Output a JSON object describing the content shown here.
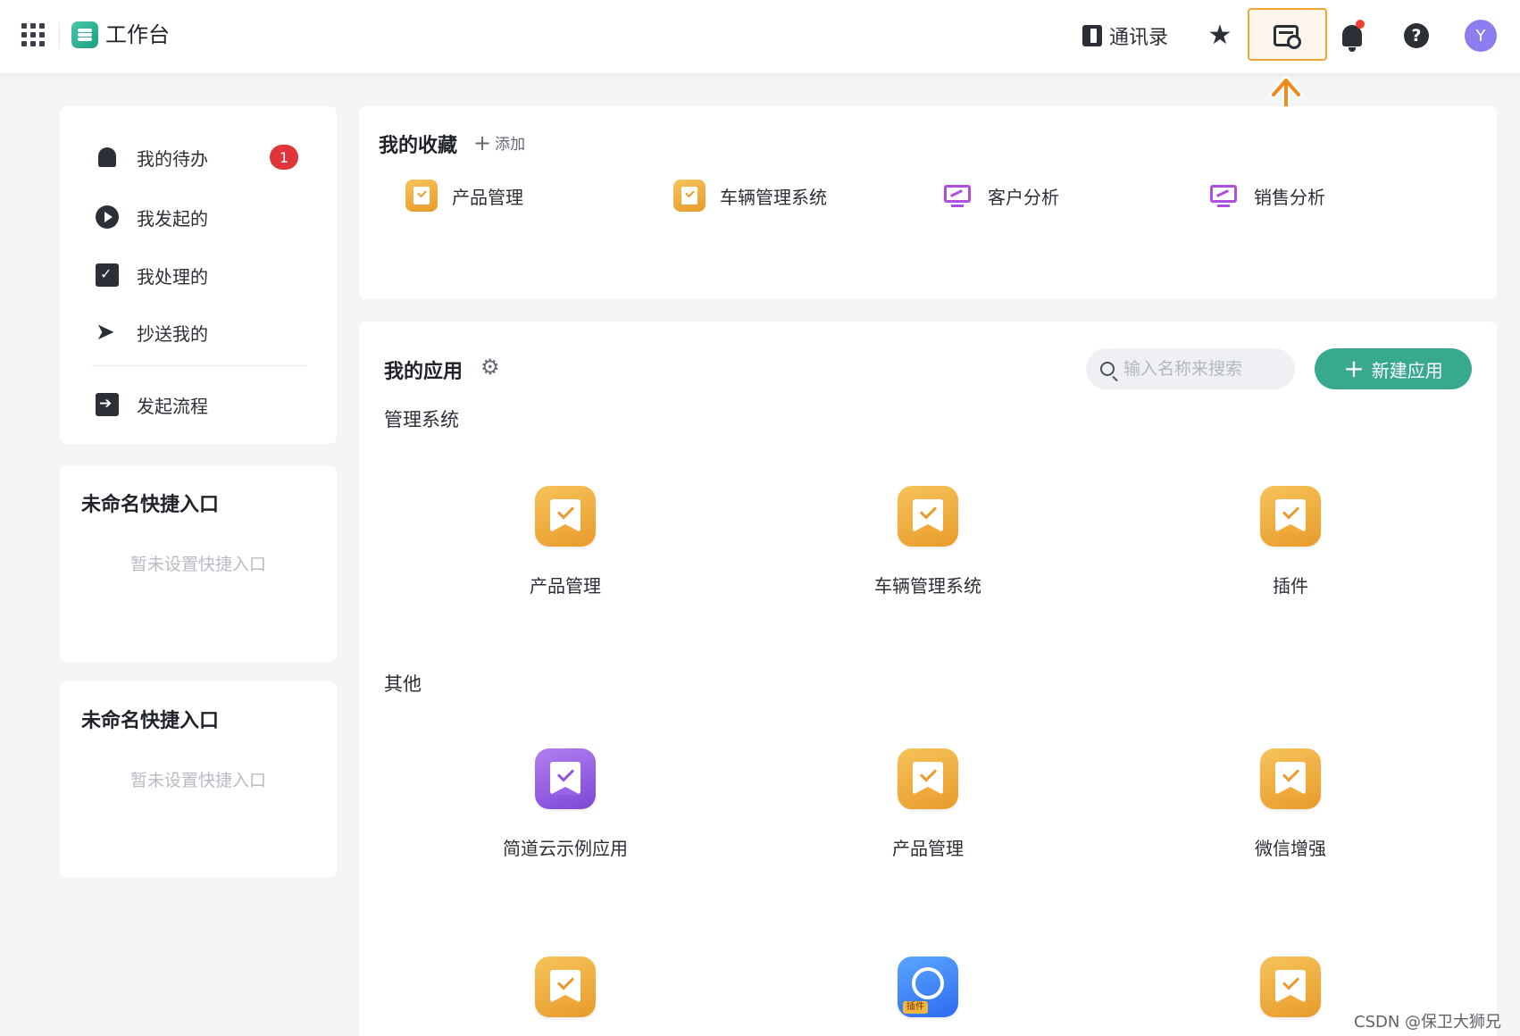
{
  "topbar": {
    "app_title": "工作台",
    "contacts_label": "通讯录",
    "avatar_letter": "Y",
    "icons": [
      "apps-grid-icon",
      "star-icon",
      "manage-card-icon",
      "bell-icon",
      "help-icon"
    ]
  },
  "sidebar": {
    "items": [
      {
        "label": "我的待办",
        "icon": "bell-icon",
        "badge": "1"
      },
      {
        "label": "我发起的",
        "icon": "play-circle-icon"
      },
      {
        "label": "我处理的",
        "icon": "check-box-icon"
      },
      {
        "label": "抄送我的",
        "icon": "send-icon"
      },
      {
        "label": "发起流程",
        "icon": "start-flow-icon"
      }
    ]
  },
  "quick_entries": [
    {
      "title": "未命名快捷入口",
      "empty_text": "暂未设置快捷入口"
    },
    {
      "title": "未命名快捷入口",
      "empty_text": "暂未设置快捷入口"
    }
  ],
  "favorites": {
    "title": "我的收藏",
    "add_label": "添加",
    "items": [
      {
        "label": "产品管理",
        "icon": "form-app-icon"
      },
      {
        "label": "车辆管理系统",
        "icon": "form-app-icon"
      },
      {
        "label": "客户分析",
        "icon": "dashboard-icon"
      },
      {
        "label": "销售分析",
        "icon": "dashboard-icon"
      }
    ]
  },
  "apps": {
    "title": "我的应用",
    "search_placeholder": "输入名称来搜索",
    "new_app_label": "新建应用",
    "groups": [
      {
        "name": "管理系统",
        "apps": [
          "产品管理",
          "车辆管理系统",
          "插件"
        ]
      },
      {
        "name": "其他",
        "apps": [
          "简道云示例应用",
          "产品管理",
          "微信增强"
        ]
      }
    ],
    "plugin_tag": "插件"
  },
  "watermark": "CSDN @保卫大狮兄",
  "colors": {
    "accent": "#38a88f",
    "highlight": "#f2a536",
    "badge": "#e0363b",
    "app_orange": "#e89b2b",
    "app_purple": "#7d47d6"
  }
}
